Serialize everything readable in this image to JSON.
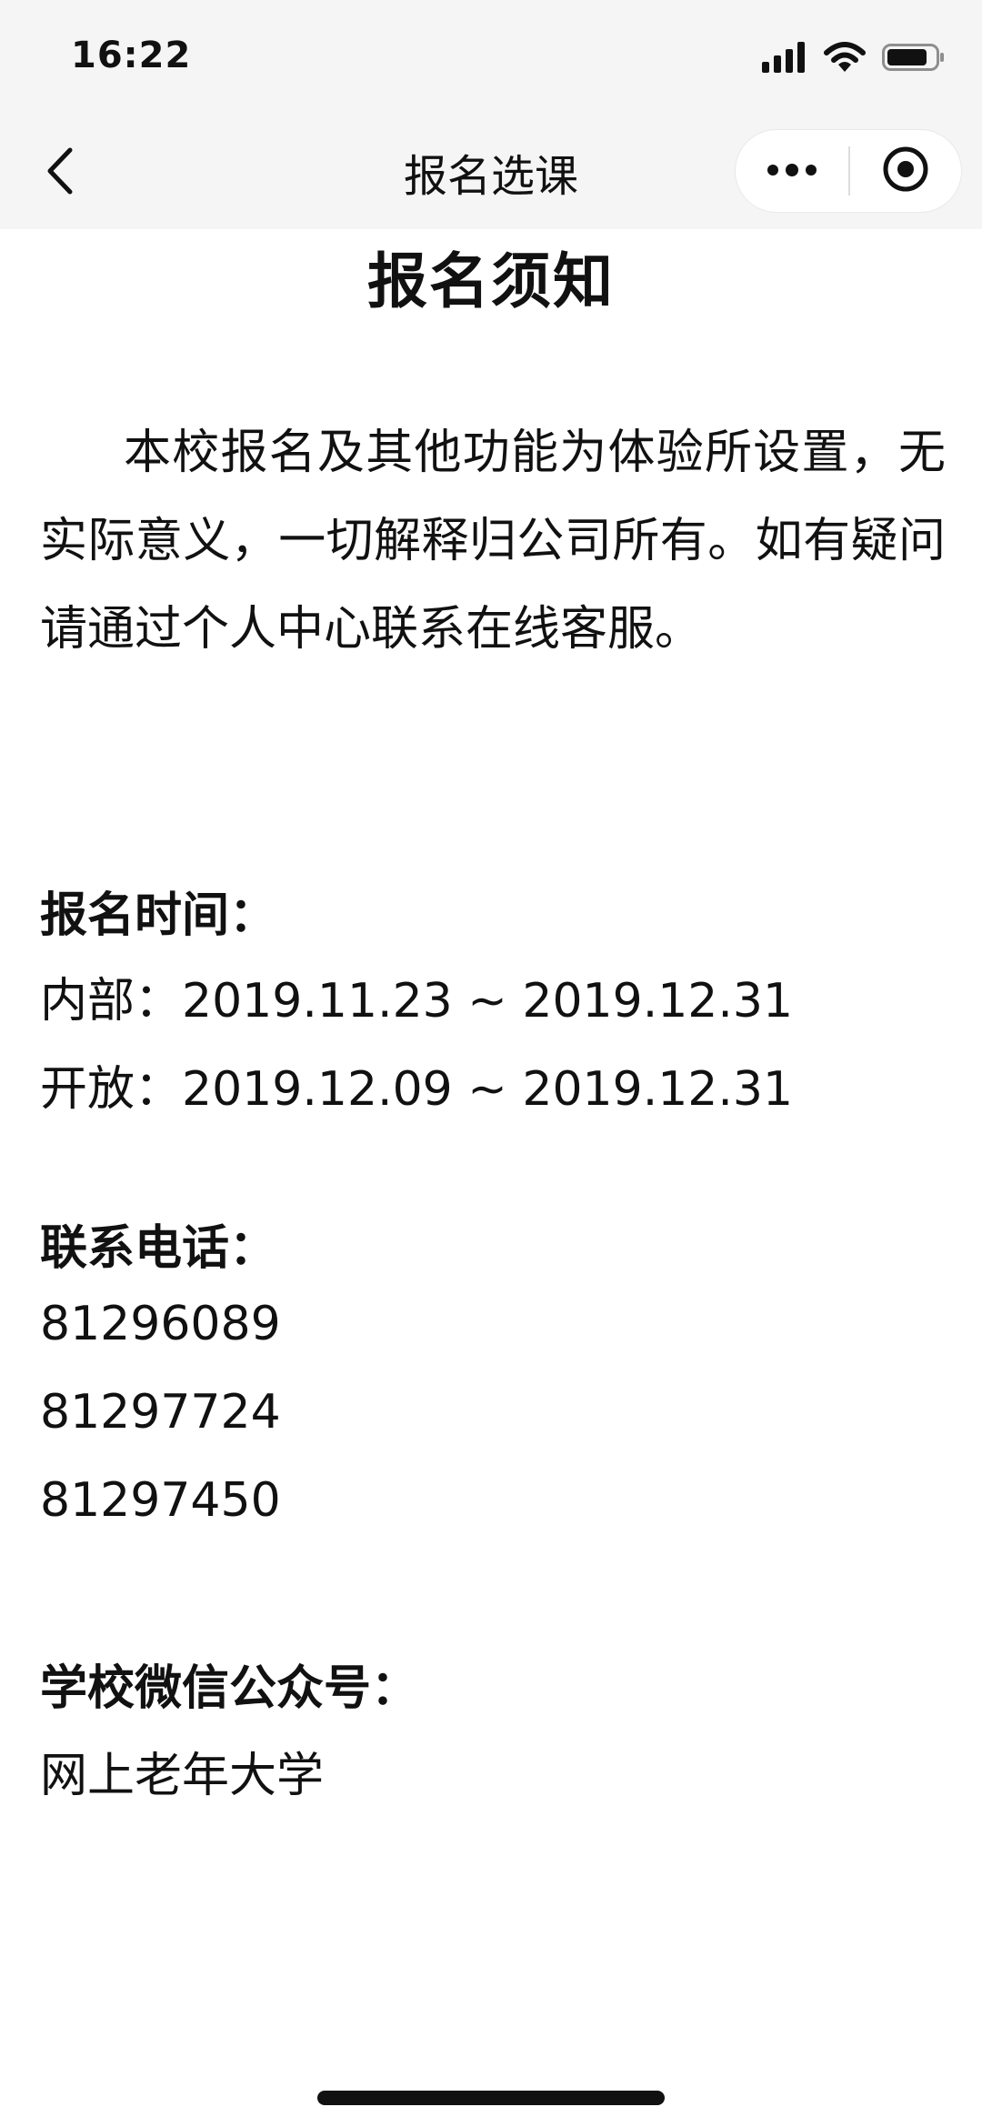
{
  "status_bar": {
    "time": "16:22",
    "icons": [
      "signal-icon",
      "wifi-icon",
      "battery-icon"
    ]
  },
  "nav": {
    "title": "报名选课",
    "back_icon": "chevron-left-icon",
    "more_icon": "more-dots-icon",
    "close_icon": "target-close-icon"
  },
  "notice": {
    "title": "报名须知",
    "intro": "本校报名及其他功能为体验所设置，无实际意义，一切解释归公司所有。如有疑问请通过个人中心联系在线客服。",
    "registration": {
      "heading": "报名时间：",
      "internal": "内部：2019.11.23 ~ 2019.12.31",
      "open": "开放：2019.12.09 ~ 2019.12.31"
    },
    "contact": {
      "heading": "联系电话：",
      "phones": [
        "81296089",
        "81297724",
        "81297450"
      ]
    },
    "wechat": {
      "heading": "学校微信公众号：",
      "name": "网上老年大学"
    }
  },
  "colors": {
    "bar_background": "#f5f5f5",
    "page_background": "#ffffff",
    "text": "#111111"
  }
}
